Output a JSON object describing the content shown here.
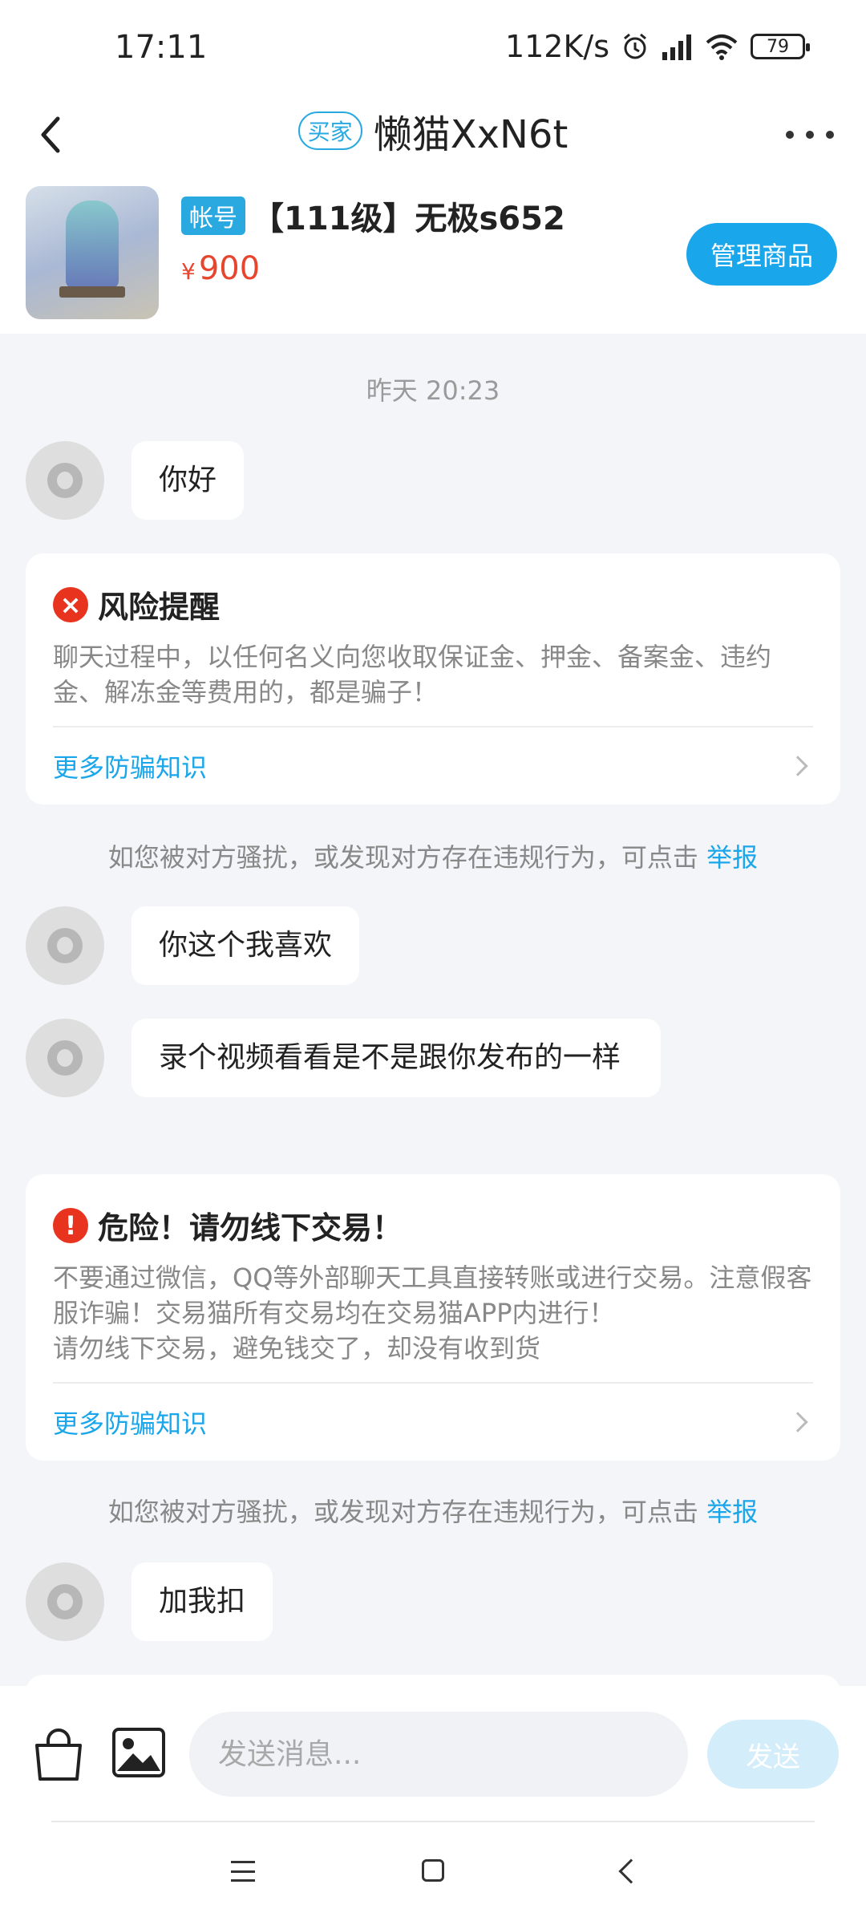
{
  "status_bar": {
    "time": "17:11",
    "net_speed": "112K/s",
    "battery": "79"
  },
  "header": {
    "role_badge": "买家",
    "title": "懒猫XxN6t"
  },
  "product": {
    "tag": "帐号",
    "title": "【111级】无极s652",
    "price_symbol": "¥",
    "price": "900",
    "manage_label": "管理商品"
  },
  "chat": {
    "timestamp": "昨天  20:23",
    "msg1": "你好",
    "risk_card": {
      "icon": "×",
      "title": "风险提醒",
      "text": "聊天过程中，以任何名义向您收取保证金、押金、备案金、违约金、解冻金等费用的，都是骗子！",
      "link": "更多防骗知识"
    },
    "notice1": "如您被对方骚扰，或发现对方存在违规行为，可点击",
    "report1": "举报",
    "msg2": "你这个我喜欢",
    "msg3": "录个视频看看是不是跟你发布的一样",
    "danger_card": {
      "icon": "!",
      "title": "危险！请勿线下交易！",
      "text1": "不要通过微信，QQ等外部聊天工具直接转账或进行交易。注意假客服诈骗！交易猫所有交易均在交易猫APP内进行！",
      "text2": "请勿线下交易，避免钱交了，却没有收到货",
      "link": "更多防骗知识"
    },
    "notice2": "如您被对方骚扰，或发现对方存在违规行为，可点击",
    "report2": "举报",
    "msg4": "加我扣"
  },
  "input": {
    "placeholder": "发送消息...",
    "send_label": "发送"
  },
  "colors": {
    "accent": "#1aa6ea",
    "price": "#e8452e",
    "danger": "#e8341f"
  }
}
